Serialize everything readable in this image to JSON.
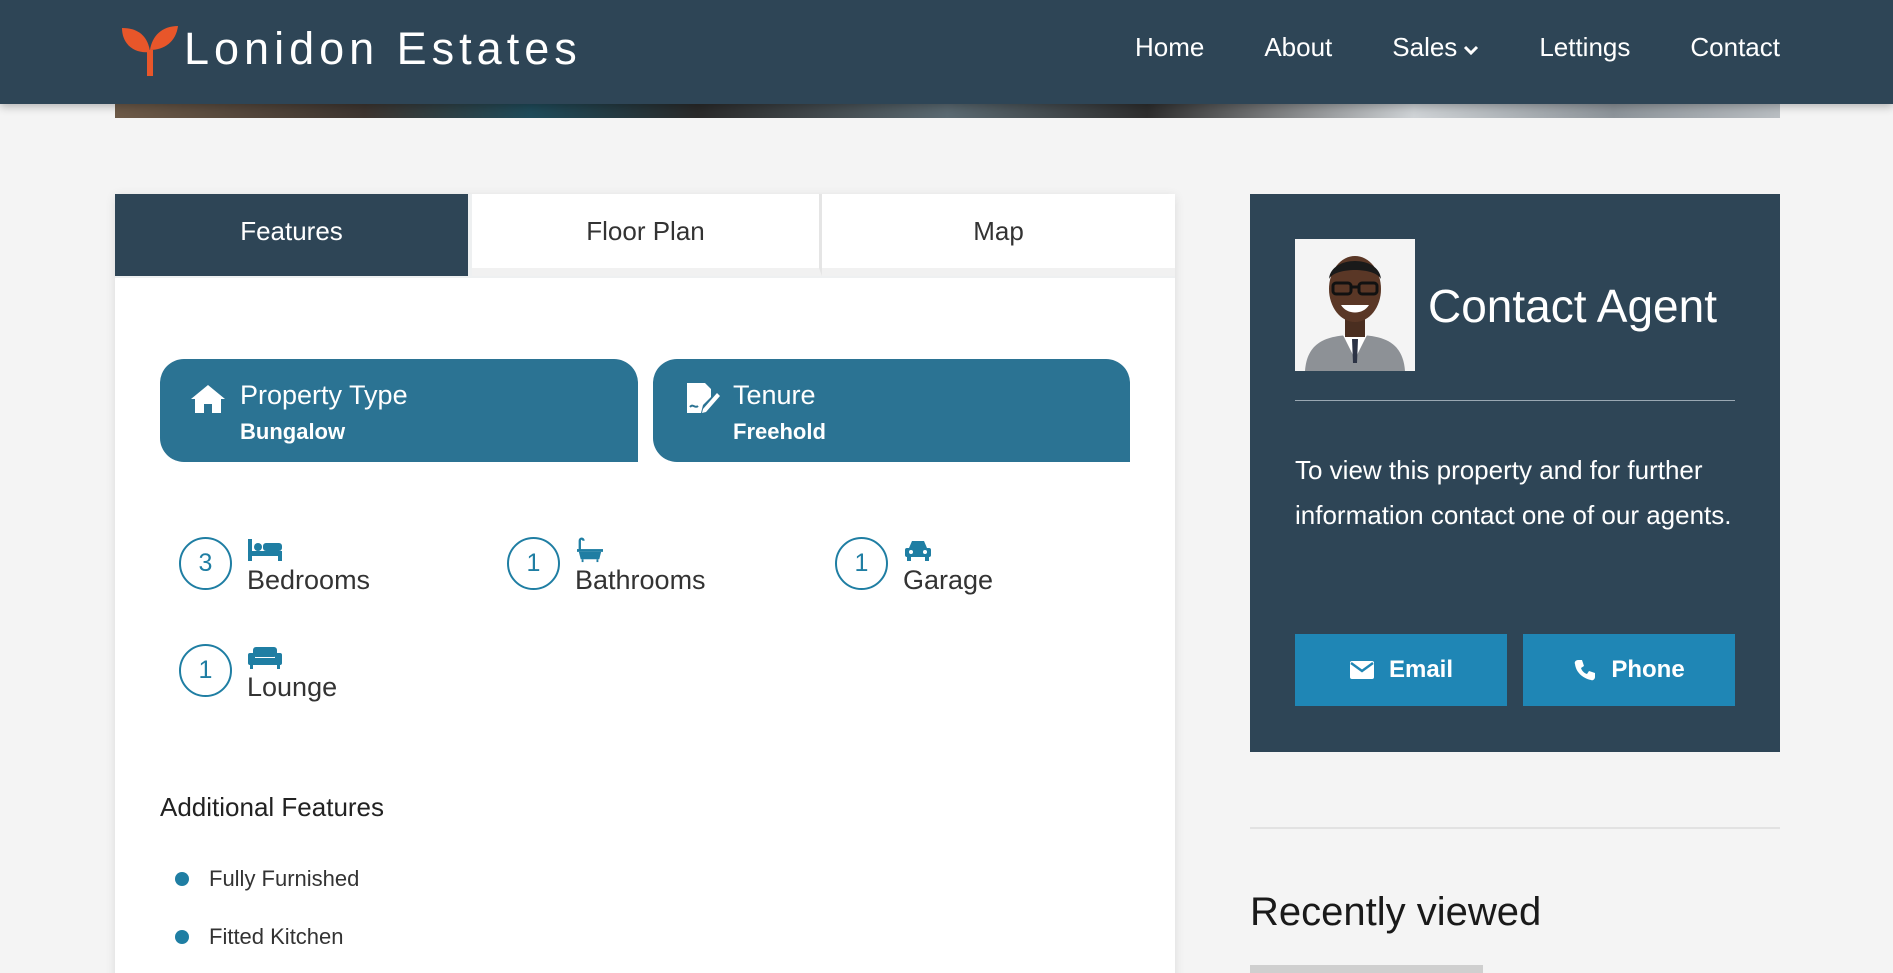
{
  "brand": {
    "name": "Lonidon Estates",
    "accent": "#e8562a",
    "header_bg": "#2e4556"
  },
  "nav": {
    "items": [
      {
        "label": "Home"
      },
      {
        "label": "About"
      },
      {
        "label": "Sales"
      },
      {
        "label": "Lettings"
      },
      {
        "label": "Contact"
      }
    ]
  },
  "tabs": [
    {
      "label": "Features",
      "active": true
    },
    {
      "label": "Floor Plan",
      "active": false
    },
    {
      "label": "Map",
      "active": false
    }
  ],
  "property": {
    "type_title": "Property Type",
    "type_value": "Bungalow",
    "tenure_title": "Tenure",
    "tenure_value": "Freehold"
  },
  "rooms": [
    {
      "count": "3",
      "label": "Bedrooms",
      "icon": "bed-icon"
    },
    {
      "count": "1",
      "label": "Bathrooms",
      "icon": "bath-icon"
    },
    {
      "count": "1",
      "label": "Garage",
      "icon": "car-icon"
    },
    {
      "count": "1",
      "label": "Lounge",
      "icon": "sofa-icon"
    }
  ],
  "additional": {
    "title": "Additional Features",
    "items": [
      "Fully Furnished",
      "Fitted Kitchen"
    ]
  },
  "agent": {
    "title": "Contact Agent",
    "text": "To view this property and for further information contact one of our agents.",
    "email_label": "Email",
    "phone_label": "Phone"
  },
  "recent": {
    "title": "Recently viewed"
  }
}
